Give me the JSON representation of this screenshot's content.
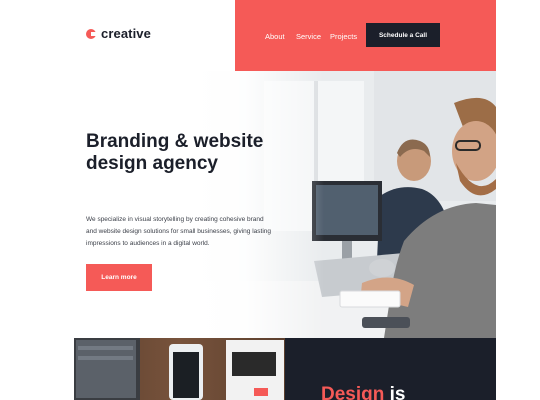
{
  "brand": {
    "name": "creative"
  },
  "nav": {
    "links": [
      "About",
      "Service",
      "Projects"
    ],
    "cta": "Schedule a Call"
  },
  "hero": {
    "title": "Branding & website design agency",
    "description": "We specialize in visual storytelling by creating cohesive brand and website design solutions for small businesses, giving lasting impressions to audiences in a digital world.",
    "button": "Learn more"
  },
  "section2": {
    "heading_accent": "Design",
    "heading_rest": " is"
  },
  "colors": {
    "accent": "#f55a57",
    "dark": "#1b1f2a",
    "white": "#ffffff"
  },
  "icons": [
    "logo-mark-icon"
  ]
}
